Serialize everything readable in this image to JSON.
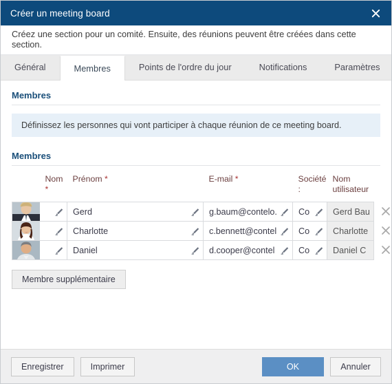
{
  "window": {
    "title": "Créer un meeting board",
    "close_icon": "close-icon"
  },
  "subtitle": "Créez une section pour un comité. Ensuite, des réunions peuvent être créées dans cette section.",
  "tabs": [
    {
      "label": "Général",
      "active": false
    },
    {
      "label": "Membres",
      "active": true
    },
    {
      "label": "Points de l'ordre du jour",
      "active": false
    },
    {
      "label": "Notifications",
      "active": false
    },
    {
      "label": "Paramètres",
      "active": false
    }
  ],
  "sections": {
    "members_heading": "Membres",
    "info_banner": "Définissez les personnes qui vont participer à chaque réunion de ce meeting board.",
    "table_heading": "Membres"
  },
  "table": {
    "columns": [
      {
        "key": "photo",
        "label": ""
      },
      {
        "key": "nom",
        "label": "Nom",
        "required": true
      },
      {
        "key": "prenom",
        "label": "Prénom",
        "required": true
      },
      {
        "key": "email",
        "label": "E-mail",
        "required": true
      },
      {
        "key": "societe",
        "label": "Société :",
        "required": false
      },
      {
        "key": "utilisateur",
        "label": "Nom utilisateur",
        "required": false
      },
      {
        "key": "delete",
        "label": ""
      }
    ],
    "header_labels": {
      "nom": "Nom",
      "prenom": "Prénom",
      "email": "E-mail",
      "societe_line1": "Société",
      "societe_line2": ":",
      "utilisateur_line1": "Nom",
      "utilisateur_line2": "utilisateur"
    },
    "rows": [
      {
        "avatar": "avatar-photo-gerd",
        "nom": "",
        "prenom": "Gerd",
        "email": "g.baum@contelo.",
        "societe": "Co",
        "utilisateur": "Gerd Bau"
      },
      {
        "avatar": "avatar-photo-charlotte",
        "nom": "",
        "prenom": "Charlotte",
        "email": "c.bennett@contel",
        "societe": "Co",
        "utilisateur": "Charlotte"
      },
      {
        "avatar": "avatar-photo-daniel",
        "nom": "",
        "prenom": "Daniel",
        "email": "d.cooper@contel",
        "societe": "Co",
        "utilisateur": "Daniel C"
      }
    ],
    "edit_icon": "pencil-icon",
    "delete_icon": "close-x-icon"
  },
  "add_member_button": "Membre supplémentaire",
  "footer": {
    "save": "Enregistrer",
    "print": "Imprimer",
    "ok": "OK",
    "cancel": "Annuler"
  },
  "colors": {
    "titlebar": "#0d4a7c",
    "accent_heading": "#1a4f7a",
    "info_banner_bg": "#e7f0f8",
    "primary_button": "#5b8fc4",
    "footer_bg": "#efeff0",
    "required_star": "#aa3333"
  }
}
